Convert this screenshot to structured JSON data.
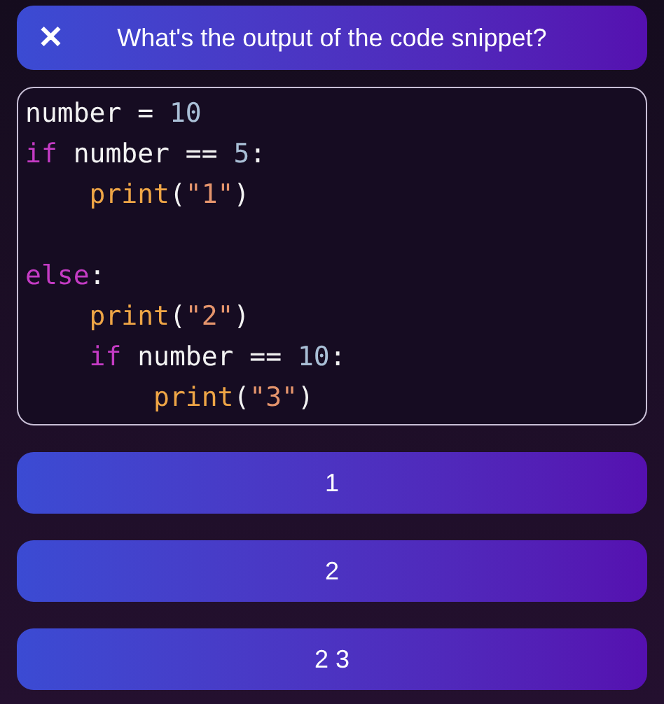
{
  "header": {
    "close_icon": "✕",
    "question": "What's the output of the code snippet?"
  },
  "code": {
    "lines": [
      {
        "kind": "code",
        "tokens": [
          {
            "kind": "plain",
            "text": "number = "
          },
          {
            "kind": "number",
            "text": "10"
          }
        ]
      },
      {
        "kind": "code",
        "tokens": [
          {
            "kind": "keyword",
            "text": "if"
          },
          {
            "kind": "plain",
            "text": " number == "
          },
          {
            "kind": "number",
            "text": "5"
          },
          {
            "kind": "plain",
            "text": ":"
          }
        ]
      },
      {
        "kind": "code",
        "tokens": [
          {
            "kind": "function",
            "text": "    print"
          },
          {
            "kind": "plain",
            "text": "("
          },
          {
            "kind": "string",
            "text": "\"1\""
          },
          {
            "kind": "plain",
            "text": ")"
          }
        ]
      },
      {
        "kind": "blank"
      },
      {
        "kind": "code",
        "tokens": [
          {
            "kind": "keyword",
            "text": "else"
          },
          {
            "kind": "plain",
            "text": ":"
          }
        ]
      },
      {
        "kind": "code",
        "tokens": [
          {
            "kind": "function",
            "text": "    print"
          },
          {
            "kind": "plain",
            "text": "("
          },
          {
            "kind": "string",
            "text": "\"2\""
          },
          {
            "kind": "plain",
            "text": ")"
          }
        ]
      },
      {
        "kind": "code",
        "tokens": [
          {
            "kind": "keyword",
            "text": "    if"
          },
          {
            "kind": "plain",
            "text": " number == "
          },
          {
            "kind": "number",
            "text": "10"
          },
          {
            "kind": "plain",
            "text": ":"
          }
        ]
      },
      {
        "kind": "code",
        "tokens": [
          {
            "kind": "function",
            "text": "        print"
          },
          {
            "kind": "plain",
            "text": "("
          },
          {
            "kind": "string",
            "text": "\"3\""
          },
          {
            "kind": "plain",
            "text": ")"
          }
        ]
      }
    ]
  },
  "answers": [
    {
      "label": "1"
    },
    {
      "label": "2"
    },
    {
      "label": "2 3"
    }
  ]
}
